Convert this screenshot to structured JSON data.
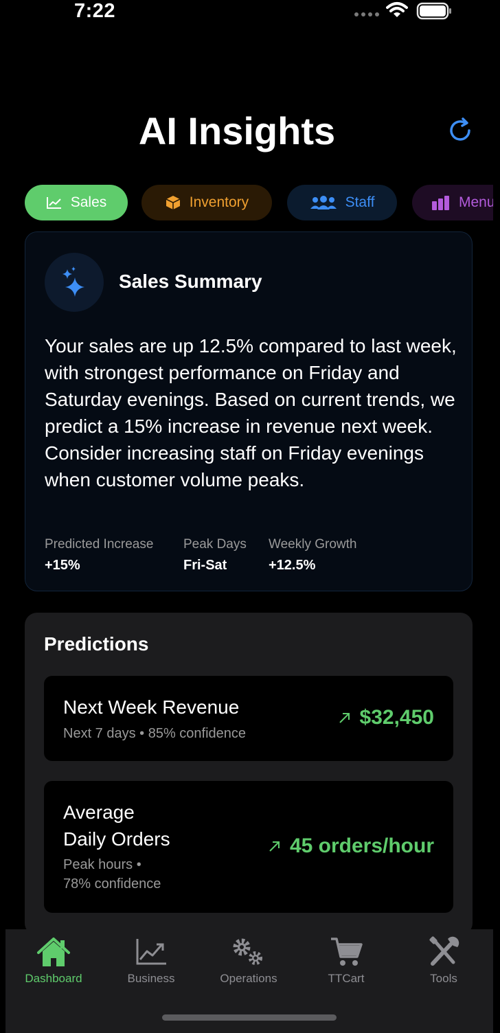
{
  "status": {
    "time": "7:22"
  },
  "header": {
    "title": "AI Insights"
  },
  "tabs": [
    {
      "label": "Sales",
      "color": "#5fcc6c"
    },
    {
      "label": "Inventory",
      "color": "#f0a030"
    },
    {
      "label": "Staff",
      "color": "#3d8ef5"
    },
    {
      "label": "Menu",
      "color": "#b35bdc"
    }
  ],
  "summary": {
    "title": "Sales Summary",
    "text": "Your sales are up 12.5% compared to last week, with strongest performance on Friday and Saturday evenings. Based on current trends, we predict a 15% increase in revenue next week. Consider increasing staff on Friday evenings when customer volume peaks.",
    "stats": [
      {
        "label": "Predicted Increase",
        "value": "+15%"
      },
      {
        "label": "Peak Days",
        "value": "Fri-Sat"
      },
      {
        "label": "Weekly Growth",
        "value": "+12.5%"
      }
    ]
  },
  "predictions": {
    "title": "Predictions",
    "items": [
      {
        "name": "Next Week Revenue",
        "meta": "Next 7 days • 85% confidence",
        "value": "$32,450"
      },
      {
        "name_line1": "Average",
        "name_line2": "Daily Orders",
        "meta_line1": "Peak hours •",
        "meta_line2": "78% confidence",
        "value": "45 orders/hour"
      }
    ]
  },
  "nav": [
    {
      "label": "Dashboard",
      "icon": "house-icon",
      "active": true
    },
    {
      "label": "Business",
      "icon": "chart-icon"
    },
    {
      "label": "Operations",
      "icon": "gears-icon"
    },
    {
      "label": "TTCart",
      "icon": "cart-icon"
    },
    {
      "label": "Tools",
      "icon": "tools-icon"
    }
  ],
  "colors": {
    "accent": "#5fcc6c",
    "background": "#000000",
    "card": "#1c1c1e"
  }
}
